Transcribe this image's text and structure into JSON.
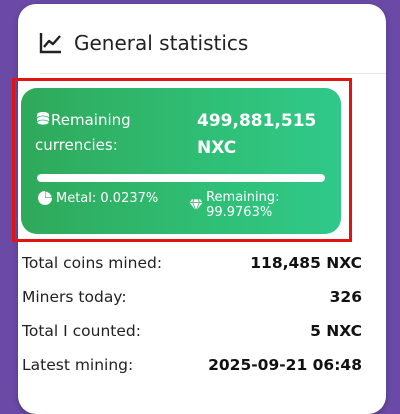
{
  "header": {
    "title": "General statistics",
    "icon": "line-chart-icon"
  },
  "remaining": {
    "label_line1": "Remaining",
    "label_line2": "currencies:",
    "value_line1": "499,881,515",
    "value_line2": "NXC",
    "progress_fraction": 0.999763,
    "metal_label": "Metal: 0.0237%",
    "remaining_label": "Remaining: 99.9763%"
  },
  "stats": [
    {
      "label": "Total coins mined:",
      "value": "118,485 NXC"
    },
    {
      "label": "Miners today:",
      "value": "326"
    },
    {
      "label": "Total I counted:",
      "value": "5 NXC"
    },
    {
      "label": "Latest mining:",
      "value": "2025-09-21 06:48"
    }
  ],
  "colors": {
    "accent_green": "#2fbf76",
    "highlight_red": "#e21313",
    "background_purple": "#6a4aa6"
  }
}
